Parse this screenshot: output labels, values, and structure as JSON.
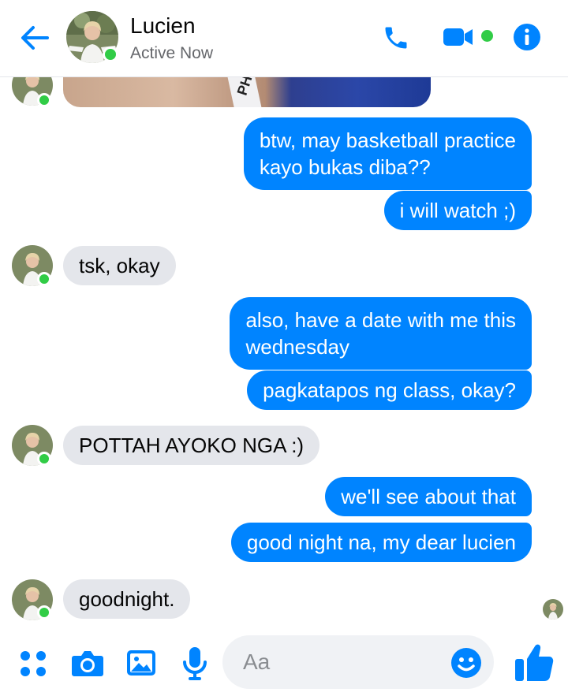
{
  "header": {
    "contact_name": "Lucien",
    "contact_status": "Active Now",
    "icons": [
      "back-arrow-icon",
      "phone-icon",
      "video-icon",
      "info-icon"
    ]
  },
  "colors": {
    "accent": "#0084ff",
    "online": "#31cc46",
    "incoming_bubble": "#e4e6eb",
    "text_secondary": "#65676b"
  },
  "previous_attachment": {
    "type": "image",
    "visible_text": "PH"
  },
  "messages": [
    {
      "from": "me",
      "lines": [
        "btw, may basketball practice",
        "kayo bukas diba??"
      ]
    },
    {
      "from": "me",
      "lines": [
        "i will watch ;)"
      ]
    },
    {
      "from": "them",
      "lines": [
        "tsk, okay"
      ]
    },
    {
      "from": "me",
      "lines": [
        "also, have a date with me this",
        "wednesday"
      ]
    },
    {
      "from": "me",
      "lines": [
        "pagkatapos ng class, okay?"
      ]
    },
    {
      "from": "them",
      "lines": [
        "POTTAH AYOKO NGA :)"
      ]
    },
    {
      "from": "me",
      "lines": [
        "we'll see about that"
      ]
    },
    {
      "from": "me",
      "lines": [
        "good night na, my dear lucien"
      ]
    },
    {
      "from": "them",
      "lines": [
        "goodnight."
      ]
    }
  ],
  "composer": {
    "placeholder": "Aa",
    "icons": [
      "apps-icon",
      "camera-icon",
      "gallery-icon",
      "microphone-icon",
      "emoji-icon",
      "thumbs-up-icon"
    ]
  }
}
